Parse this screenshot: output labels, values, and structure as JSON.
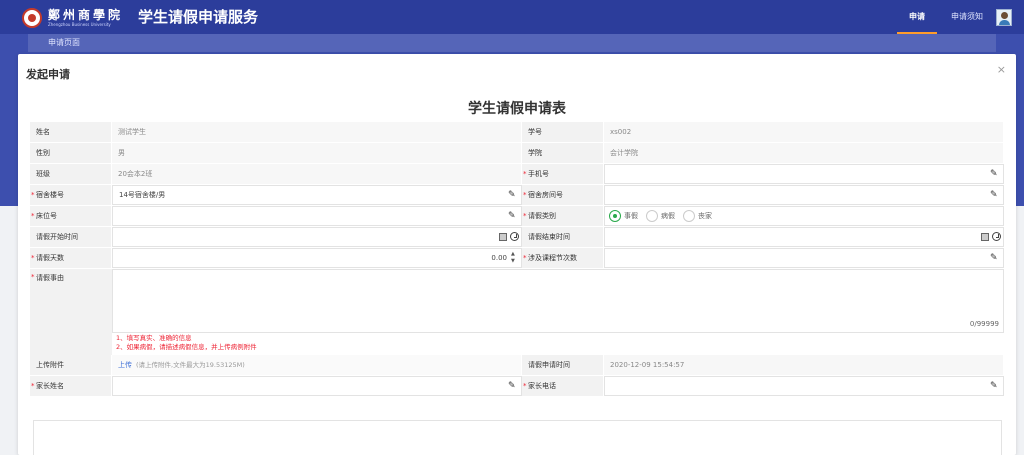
{
  "header": {
    "logo_text": "鄭州商學院",
    "logo_en": "Zhengzhou Business University",
    "app_title": "学生请假申请服务",
    "nav_apply": "申请",
    "nav_notice": "申请须知"
  },
  "breadcrumb": "申请页面",
  "modal": {
    "title": "发起申请",
    "close": "×",
    "form_title": "学生请假申请表"
  },
  "form": {
    "name_label": "姓名",
    "name_value": "测试学生",
    "sid_label": "学号",
    "sid_value": "xs002",
    "gender_label": "性别",
    "gender_value": "男",
    "college_label": "学院",
    "college_value": "会计学院",
    "class_label": "班级",
    "class_value": "20会本2班",
    "phone_label": "手机号",
    "phone_value": "",
    "dorm_building_label": "宿舍楼号",
    "dorm_building_value": "14号宿舍楼/男",
    "dorm_room_label": "宿舍房间号",
    "dorm_room_value": "",
    "bed_label": "床位号",
    "bed_value": "",
    "leave_type_label": "请假类别",
    "leave_types": [
      "事假",
      "病假",
      "丧家"
    ],
    "leave_type_selected": "事假",
    "start_label": "请假开始时间",
    "start_value": "",
    "end_label": "请假结束时间",
    "end_value": "",
    "days_label": "请假天数",
    "days_value": "0.00",
    "classes_label": "涉及课程节次数",
    "classes_value": "",
    "reason_label": "请假事由",
    "reason_counter": "0/99999",
    "note1": "1、填写真实、准确的信息",
    "note2": "2、如果病假，请描述病假信息，并上传病例附件",
    "attach_label": "上传附件",
    "attach_link": "上传",
    "attach_hint": "(请上传附件,文件最大为19.53125M)",
    "apply_time_label": "请假申请时间",
    "apply_time_value": "2020-12-09 15:54:57",
    "parent_name_label": "家长姓名",
    "parent_name_value": "",
    "parent_phone_label": "家长电话",
    "parent_phone_value": ""
  },
  "colors": {
    "header_bg": "#2c3d9b",
    "band_bg": "#3d4fae",
    "active_tab_underline": "#ff9c2a",
    "required_star": "#e22233",
    "radio_selected": "#2aa94b",
    "link": "#3d6fd6"
  }
}
